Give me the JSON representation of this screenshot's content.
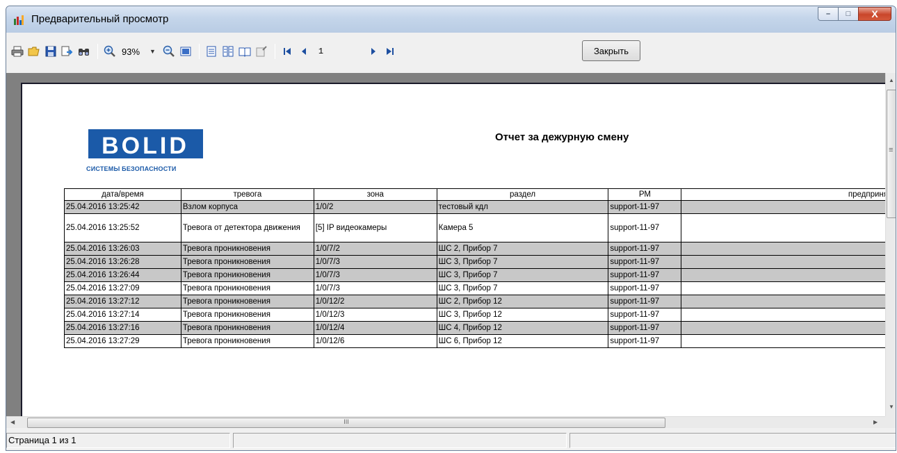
{
  "window": {
    "title": "Предварительный просмотр",
    "controls": {
      "minimize": "–",
      "maximize": "□",
      "close": "X"
    }
  },
  "toolbar": {
    "icons": [
      "print-icon",
      "open-icon",
      "save-icon",
      "export-icon",
      "find-icon",
      "zoom-in-icon",
      "zoom-out-icon",
      "full-page-icon",
      "single-page-icon",
      "multi-page-icon",
      "book-icon",
      "edit-page-icon",
      "first-page-icon",
      "prev-page-icon",
      "next-page-icon",
      "last-page-icon"
    ],
    "zoom": "93%",
    "page_number": "1",
    "close_label": "Закрыть"
  },
  "report": {
    "logo_text": "BOLID",
    "logo_subtitle": "СИСТЕМЫ БЕЗОПАСНОСТИ",
    "title": "Отчет за дежурную смену",
    "columns": [
      "дата/время",
      "тревога",
      "зона",
      "раздел",
      "РМ",
      "предприня"
    ],
    "rows": [
      [
        "25.04.2016 13:25:42",
        "Взлом корпуса",
        "1/0/2",
        "тестовый кдл",
        "support-11-97",
        ""
      ],
      [
        "25.04.2016 13:25:52",
        "Тревога от детектора движения",
        "[5] IP видеокамеры",
        "Камера 5",
        "support-11-97",
        ""
      ],
      [
        "25.04.2016 13:26:03",
        "Тревога проникновения",
        "1/0/7/2",
        "ШС 2, Прибор 7",
        "support-11-97",
        ""
      ],
      [
        "25.04.2016 13:26:28",
        "Тревога проникновения",
        "1/0/7/3",
        "ШС 3, Прибор 7",
        "support-11-97",
        ""
      ],
      [
        "25.04.2016 13:26:44",
        "Тревога проникновения",
        "1/0/7/3",
        "ШС 3, Прибор 7",
        "support-11-97",
        ""
      ],
      [
        "25.04.2016 13:27:09",
        "Тревога проникновения",
        "1/0/7/3",
        "ШС 3, Прибор 7",
        "support-11-97",
        ""
      ],
      [
        "25.04.2016 13:27:12",
        "Тревога проникновения",
        "1/0/12/2",
        "ШС 2, Прибор 12",
        "support-11-97",
        ""
      ],
      [
        "25.04.2016 13:27:14",
        "Тревога проникновения",
        "1/0/12/3",
        "ШС 3, Прибор 12",
        "support-11-97",
        ""
      ],
      [
        "25.04.2016 13:27:16",
        "Тревога проникновения",
        "1/0/12/4",
        "ШС 4, Прибор 12",
        "support-11-97",
        ""
      ],
      [
        "25.04.2016 13:27:29",
        "Тревога проникновения",
        "1/0/12/6",
        "ШС 6, Прибор 12",
        "support-11-97",
        ""
      ]
    ]
  },
  "scrollbar": {
    "grip": "III",
    "menu_glyph": "≡"
  },
  "status": {
    "page_info": "Страница 1 из 1"
  }
}
